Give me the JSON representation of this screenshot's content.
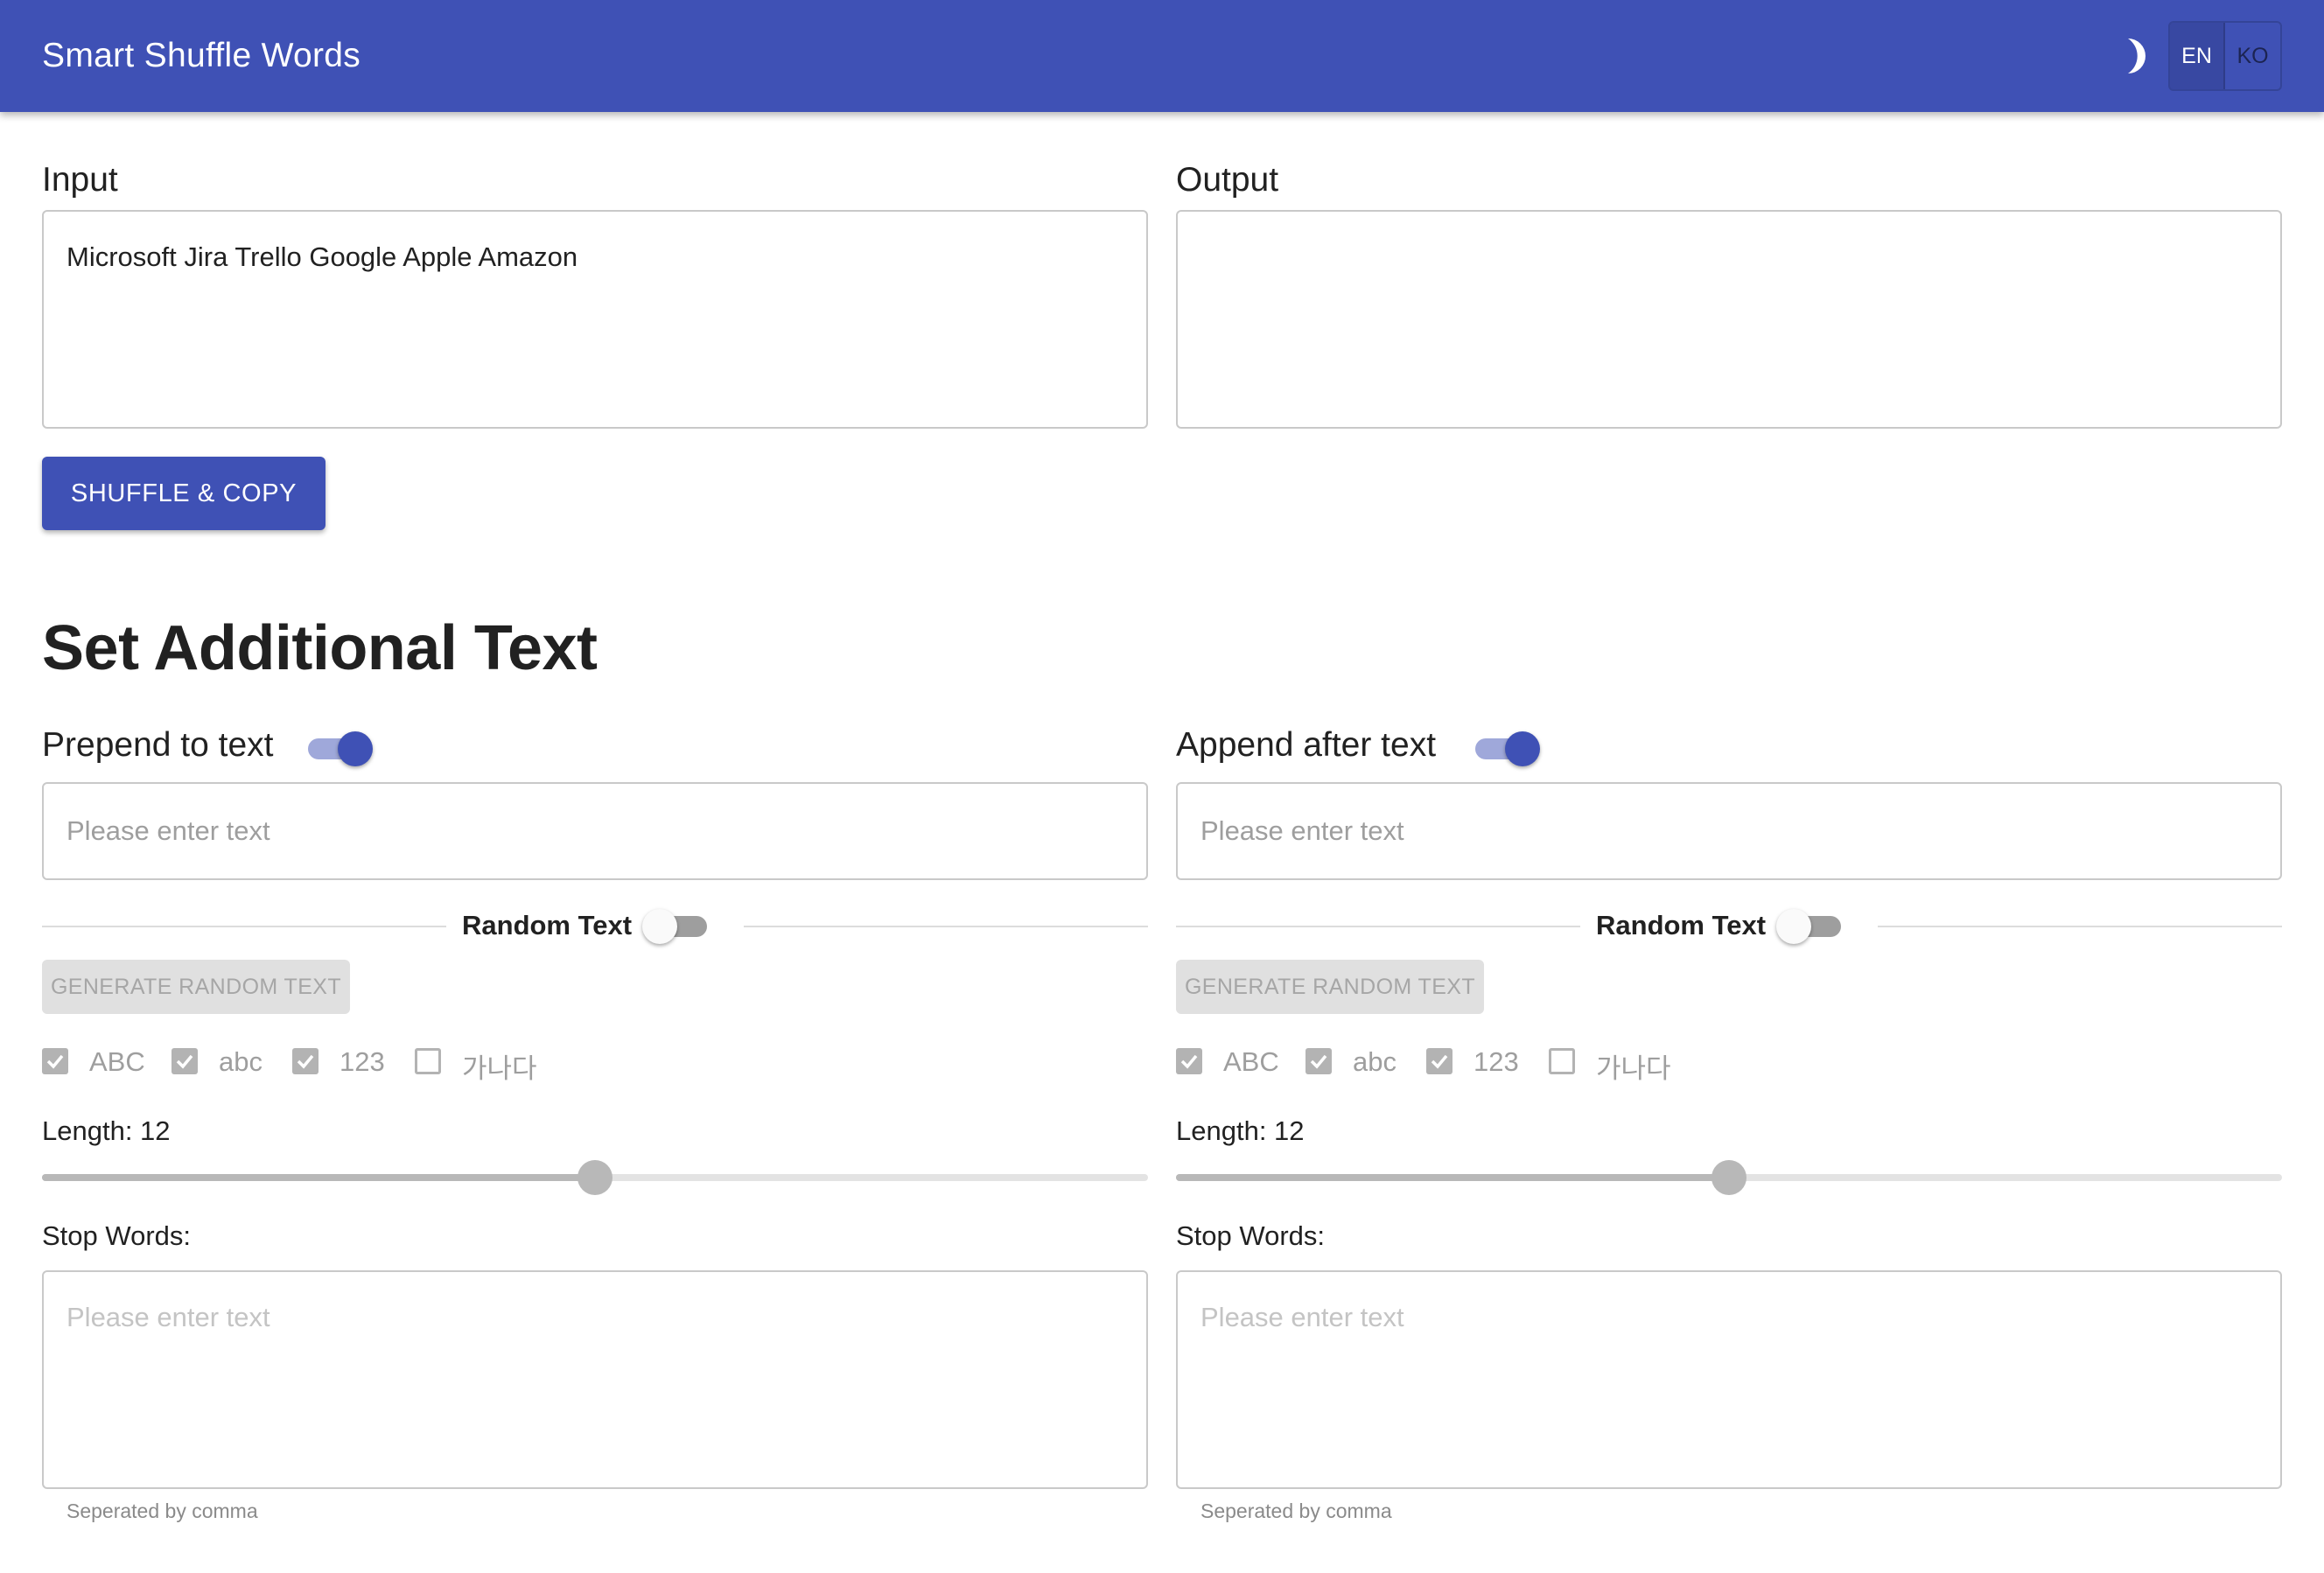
{
  "app": {
    "title": "Smart Shuffle Words"
  },
  "header": {
    "theme_icon": "moon-icon",
    "languages": [
      {
        "label": "EN",
        "active": true
      },
      {
        "label": "KO",
        "active": false
      }
    ]
  },
  "main": {
    "input_label": "Input",
    "input_value": "Microsoft Jira Trello Google Apple Amazon",
    "output_label": "Output",
    "output_value": "",
    "shuffle_button": "SHUFFLE & COPY"
  },
  "additional": {
    "title": "Set Additional Text",
    "prepend": {
      "label": "Prepend to text",
      "enabled": true,
      "placeholder": "Please enter text",
      "random_label": "Random Text",
      "random_enabled": false,
      "generate_button": "GENERATE RANDOM TEXT",
      "charsets": [
        {
          "label": "ABC",
          "checked": true
        },
        {
          "label": "abc",
          "checked": true
        },
        {
          "label": "123",
          "checked": true
        },
        {
          "label": "가나다",
          "checked": false
        }
      ],
      "length_label": "Length: 12",
      "length": 12,
      "length_fraction": 0.5,
      "stop_words_label": "Stop Words:",
      "stop_words_placeholder": "Please enter text",
      "stop_words_helper": "Seperated by comma"
    },
    "append": {
      "label": "Append after text",
      "enabled": true,
      "placeholder": "Please enter text",
      "random_label": "Random Text",
      "random_enabled": false,
      "generate_button": "GENERATE RANDOM TEXT",
      "charsets": [
        {
          "label": "ABC",
          "checked": true
        },
        {
          "label": "abc",
          "checked": true
        },
        {
          "label": "123",
          "checked": true
        },
        {
          "label": "가나다",
          "checked": false
        }
      ],
      "length_label": "Length: 12",
      "length": 12,
      "length_fraction": 0.5,
      "stop_words_label": "Stop Words:",
      "stop_words_placeholder": "Please enter text",
      "stop_words_helper": "Seperated by comma"
    }
  },
  "colors": {
    "primary": "#3f51b5",
    "primary_light": "#9fa8da",
    "disabled": "#b3b3b3"
  }
}
